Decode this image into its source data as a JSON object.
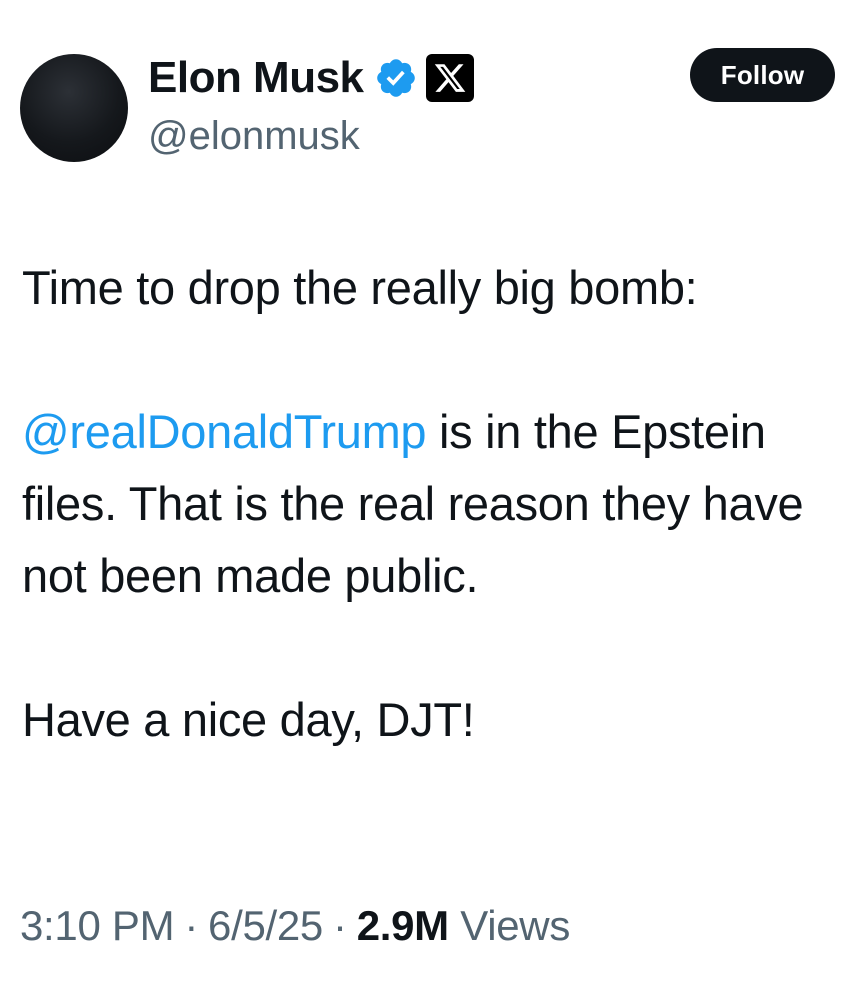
{
  "author": {
    "display_name": "Elon Musk",
    "handle": "@elonmusk",
    "verified": true,
    "affiliate_badge": "x-logo-icon"
  },
  "follow_button": {
    "label": "Follow"
  },
  "tweet": {
    "line1": "Time to drop the really big bomb:",
    "mention": "@realDonaldTrump",
    "para2_rest": " is in the Epstein files. That is the real reason they have not been made public.",
    "line3": "Have a nice day, DJT!"
  },
  "meta": {
    "time": "3:10 PM",
    "separator": "·",
    "date": "6/5/25",
    "views_count": "2.9M",
    "views_label": "Views"
  },
  "colors": {
    "text": "#0f1419",
    "secondary": "#536471",
    "link": "#1d9bf0",
    "verified": "#1d9bf0",
    "button_bg": "#0f1419"
  }
}
